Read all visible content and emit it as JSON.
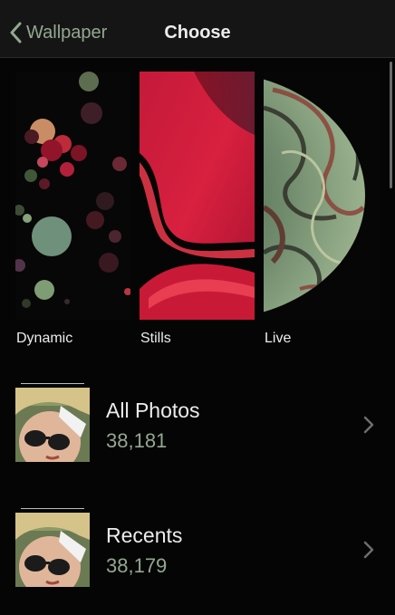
{
  "nav": {
    "back_label": "Wallpaper",
    "title": "Choose"
  },
  "wallpapers": [
    {
      "label": "Dynamic"
    },
    {
      "label": "Stills"
    },
    {
      "label": "Live"
    }
  ],
  "albums": [
    {
      "name": "All Photos",
      "count": "38,181"
    },
    {
      "name": "Recents",
      "count": "38,179"
    }
  ],
  "colors": {
    "accent": "#93a88f",
    "background": "#050505",
    "navbar": "#151516"
  }
}
